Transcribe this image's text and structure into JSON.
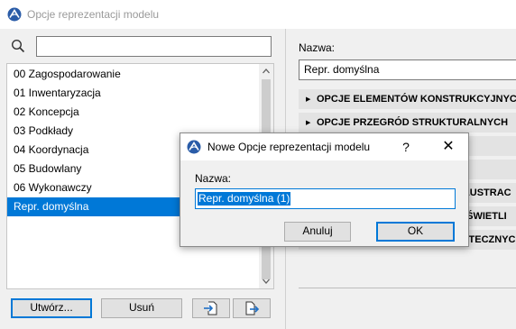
{
  "window": {
    "title": "Opcje reprezentacji modelu"
  },
  "search": {
    "placeholder": "",
    "value": ""
  },
  "sets": [
    {
      "label": "00 Zagospodarowanie",
      "selected": false
    },
    {
      "label": "01 Inwentaryzacja",
      "selected": false
    },
    {
      "label": "02 Koncepcja",
      "selected": false
    },
    {
      "label": "03 Podkłady",
      "selected": false
    },
    {
      "label": "04 Koordynacja",
      "selected": false
    },
    {
      "label": "05 Budowlany",
      "selected": false
    },
    {
      "label": "06 Wykonawczy",
      "selected": false
    },
    {
      "label": "Repr. domyślna",
      "selected": true
    }
  ],
  "buttons": {
    "create": "Utwórz...",
    "delete": "Usuń"
  },
  "details": {
    "name_label": "Nazwa:",
    "name_value": "Repr. domyślna",
    "sections": [
      "OPCJE ELEMENTÓW KONSTRUKCYJNYCH",
      "OPCJE PRZEGRÓD STRUKTURALNYCH",
      "",
      "",
      "ILUSTRAC",
      "I ŚWIETLI",
      "OTECZNYC"
    ]
  },
  "dialog": {
    "title": "Nowe Opcje reprezentacji modelu",
    "help": "?",
    "name_label": "Nazwa:",
    "name_value": "Repr. domyślna (1)",
    "cancel": "Anuluj",
    "ok": "OK"
  },
  "colors": {
    "selection": "#0078d7",
    "accent_logo": "#2a5ca8"
  }
}
